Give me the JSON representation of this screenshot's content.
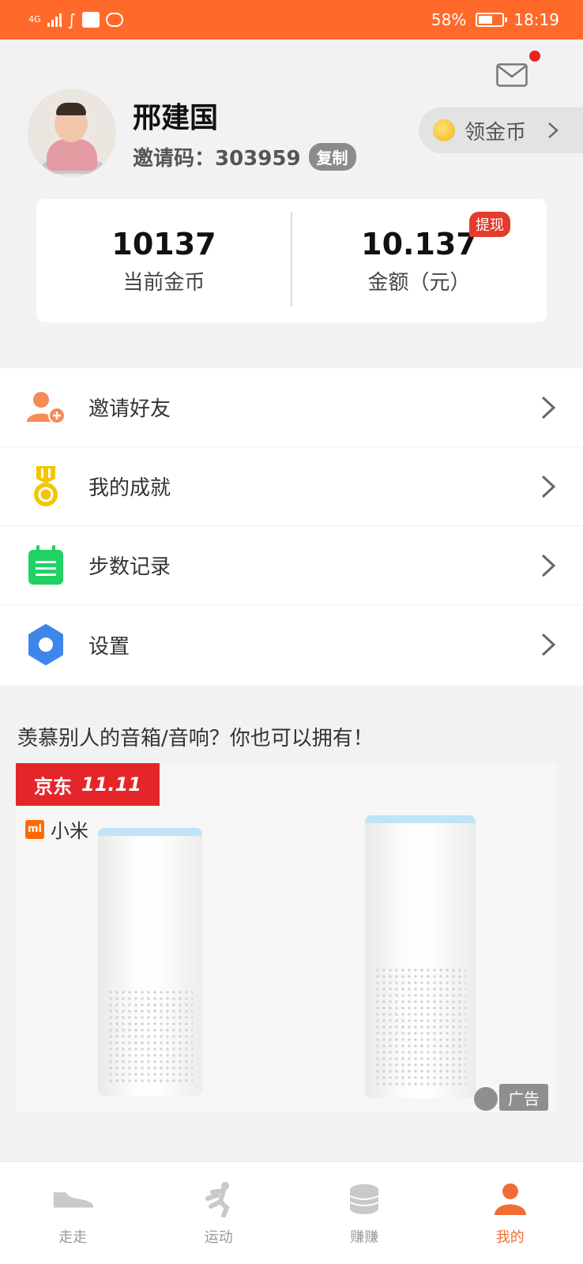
{
  "status_bar": {
    "network": "4G",
    "battery": "58%",
    "battery_level": 0.58,
    "time": "18:19"
  },
  "profile": {
    "name": "邢建国",
    "invite_label": "邀请码：303959",
    "copy_button": "复制",
    "coins_button": "领金币",
    "mail_unread": true
  },
  "stats": {
    "coins_value": "10137",
    "coins_label": "当前金币",
    "amount_value": "10.137",
    "amount_label": "金额（元）",
    "withdraw_button": "提现"
  },
  "menu": {
    "items": [
      {
        "label": "邀请好友",
        "icon": "add-user-icon",
        "color": "#f58c57"
      },
      {
        "label": "我的成就",
        "icon": "medal-icon",
        "color": "#f2c600"
      },
      {
        "label": "步数记录",
        "icon": "calendar-list-icon",
        "color": "#1fd263"
      },
      {
        "label": "设置",
        "icon": "gear-icon",
        "color": "#3f86ea"
      }
    ]
  },
  "ad": {
    "title": "羡慕别人的音箱/音响？你也可以拥有！",
    "jd_brand": "京东",
    "jd_event": "11.11",
    "mi_label": "小米",
    "ad_badge": "广告"
  },
  "tabbar": {
    "items": [
      {
        "label": "走走",
        "active": false
      },
      {
        "label": "运动",
        "active": false
      },
      {
        "label": "赚赚",
        "active": false
      },
      {
        "label": "我的",
        "active": true
      }
    ]
  },
  "colors": {
    "accent": "#ff6a2a",
    "active_tab": "#f26d34",
    "withdraw_badge": "#e33b2d",
    "background": "#f2f2f2"
  }
}
